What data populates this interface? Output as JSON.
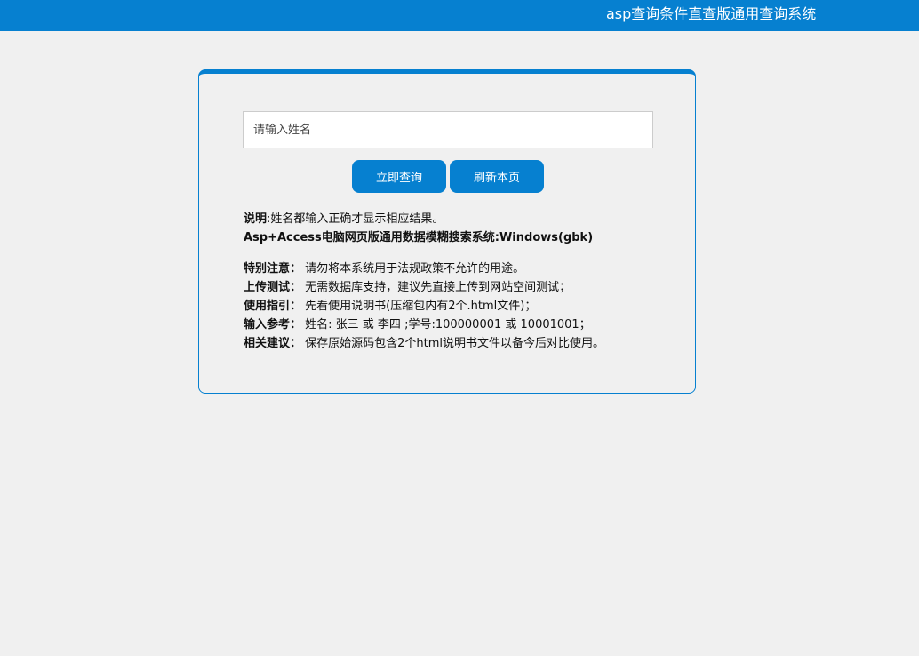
{
  "header": {
    "title": "asp查询条件直查版通用查询系统"
  },
  "search": {
    "placeholder": "请输入姓名",
    "value": ""
  },
  "buttons": {
    "query": "立即查询",
    "refresh": "刷新本页"
  },
  "notes": {
    "desc_label": "说明",
    "desc_text": ":姓名都输入正确才显示相应结果。",
    "subtitle": "Asp+Access电脑网页版通用数据模糊搜索系统:Windows(gbk)",
    "items": [
      {
        "label": "特别注意：",
        "text": "请勿将本系统用于法规政策不允许的用途。"
      },
      {
        "label": "上传测试：",
        "text": "无需数据库支持，建议先直接上传到网站空间测试；"
      },
      {
        "label": "使用指引：",
        "text": "先看使用说明书(压缩包内有2个.html文件)；"
      },
      {
        "label": "输入参考：",
        "text": "姓名: 张三 或 李四 ;学号:100000001 或 10001001；"
      },
      {
        "label": "相关建议：",
        "text": "保存原始源码包含2个html说明书文件以备今后对比使用。"
      }
    ]
  }
}
